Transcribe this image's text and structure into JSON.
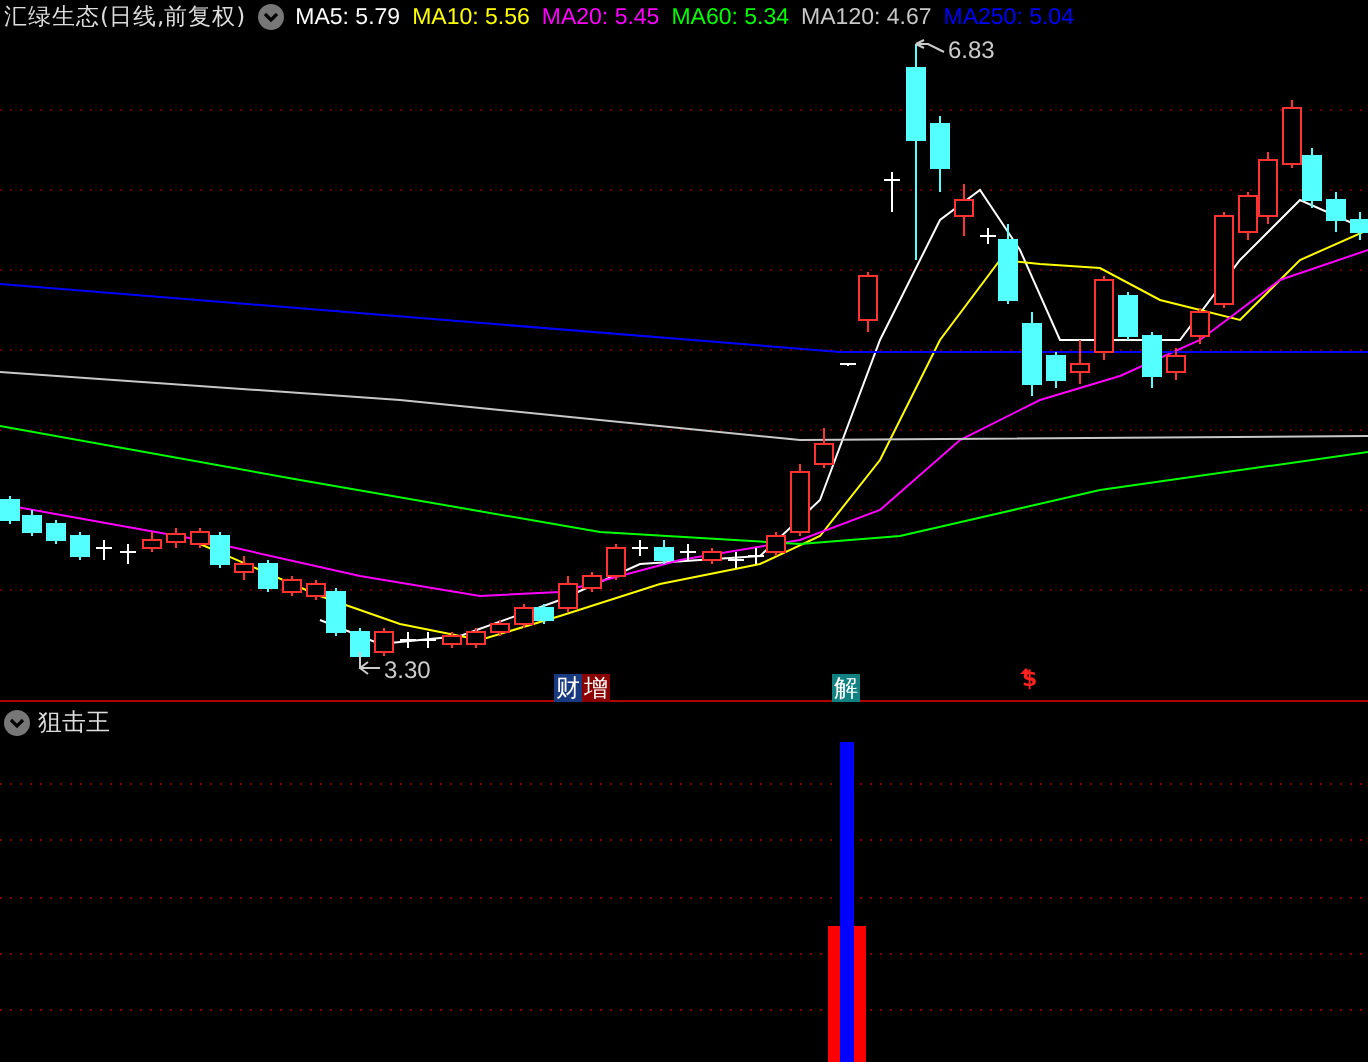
{
  "chart": {
    "title": "汇绿生态(日线,前复权)",
    "ma_legend": [
      {
        "label": "MA5: 5.79",
        "color": "#ffffff"
      },
      {
        "label": "MA10: 5.56",
        "color": "#ffff00"
      },
      {
        "label": "MA20: 5.45",
        "color": "#ff00ff"
      },
      {
        "label": "MA60: 5.34",
        "color": "#00ff00"
      },
      {
        "label": "MA120: 4.67",
        "color": "#c8c8c8"
      },
      {
        "label": "MA250: 5.04",
        "color": "#0000ff"
      }
    ],
    "price_labels": [
      {
        "kind": "high",
        "text": "6.83"
      },
      {
        "kind": "low",
        "text": "3.30"
      }
    ],
    "event_markers": [
      {
        "kind": "pair",
        "texts": [
          "财",
          "增"
        ]
      },
      {
        "kind": "tag",
        "text": "解"
      },
      {
        "kind": "dollar",
        "text": "$"
      }
    ]
  },
  "indicator": {
    "title": "狙击王"
  }
}
